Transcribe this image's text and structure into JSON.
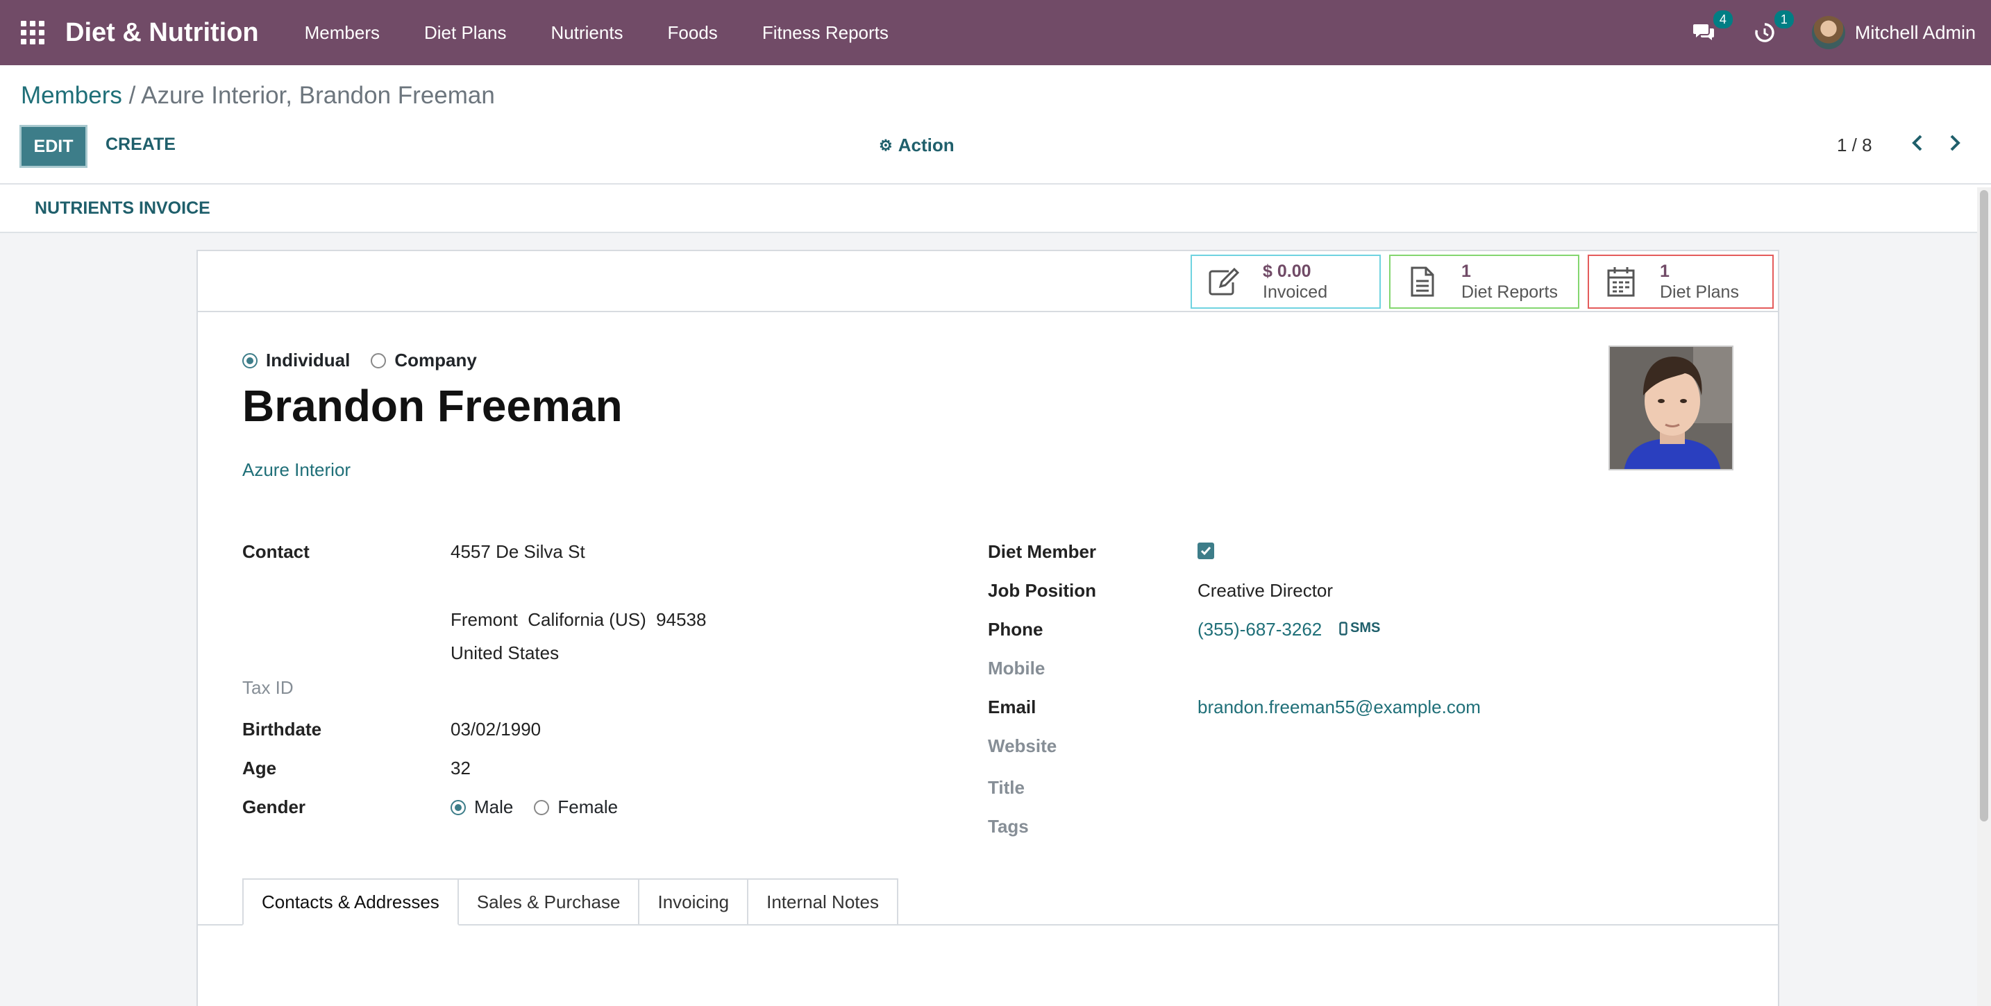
{
  "navbar": {
    "brand": "Diet & Nutrition",
    "menu": [
      {
        "label": "Members"
      },
      {
        "label": "Diet Plans"
      },
      {
        "label": "Nutrients"
      },
      {
        "label": "Foods"
      },
      {
        "label": "Fitness Reports"
      }
    ],
    "messages_count": "4",
    "activities_count": "1",
    "user_name": "Mitchell Admin",
    "color": "#714b67"
  },
  "breadcrumb": {
    "parent": "Members",
    "separator": " / ",
    "current": "Azure Interior, Brandon Freeman"
  },
  "toolbar": {
    "edit_label": "EDIT",
    "create_label": "CREATE",
    "action_label": "Action",
    "pager": "1 / 8"
  },
  "statusbar": {
    "invoice_button": "NUTRIENTS INVOICE"
  },
  "stat_buttons": [
    {
      "value": "$ 0.00",
      "label": "Invoiced",
      "icon": "pencil-square-icon",
      "border": "#6fd3e0"
    },
    {
      "value": "1",
      "label": "Diet Reports",
      "icon": "document-icon",
      "border": "#84d66f"
    },
    {
      "value": "1",
      "label": "Diet Plans",
      "icon": "calendar-icon",
      "border": "#e45b5b"
    }
  ],
  "company_type": {
    "options": [
      "Individual",
      "Company"
    ],
    "selected": "Individual"
  },
  "partner": {
    "name": "Brandon Freeman",
    "company": "Azure Interior"
  },
  "left_fields": {
    "contact_label": "Contact",
    "street": "4557 De Silva St",
    "city_line": "Fremont  California (US)  94538",
    "country": "United States",
    "tax_id_label": "Tax ID",
    "birthdate_label": "Birthdate",
    "birthdate": "03/02/1990",
    "age_label": "Age",
    "age": "32",
    "gender_label": "Gender",
    "gender_options": [
      "Male",
      "Female"
    ],
    "gender_selected": "Male"
  },
  "right_fields": {
    "diet_member_label": "Diet Member",
    "diet_member": true,
    "job_position_label": "Job Position",
    "job_position": "Creative Director",
    "phone_label": "Phone",
    "phone": "(355)-687-3262",
    "sms_label": "SMS",
    "mobile_label": "Mobile",
    "email_label": "Email",
    "email": "brandon.freeman55@example.com",
    "website_label": "Website",
    "title_label": "Title",
    "tags_label": "Tags"
  },
  "tabs": [
    {
      "label": "Contacts & Addresses",
      "active": true
    },
    {
      "label": "Sales & Purchase",
      "active": false
    },
    {
      "label": "Invoicing",
      "active": false
    },
    {
      "label": "Internal Notes",
      "active": false
    }
  ]
}
